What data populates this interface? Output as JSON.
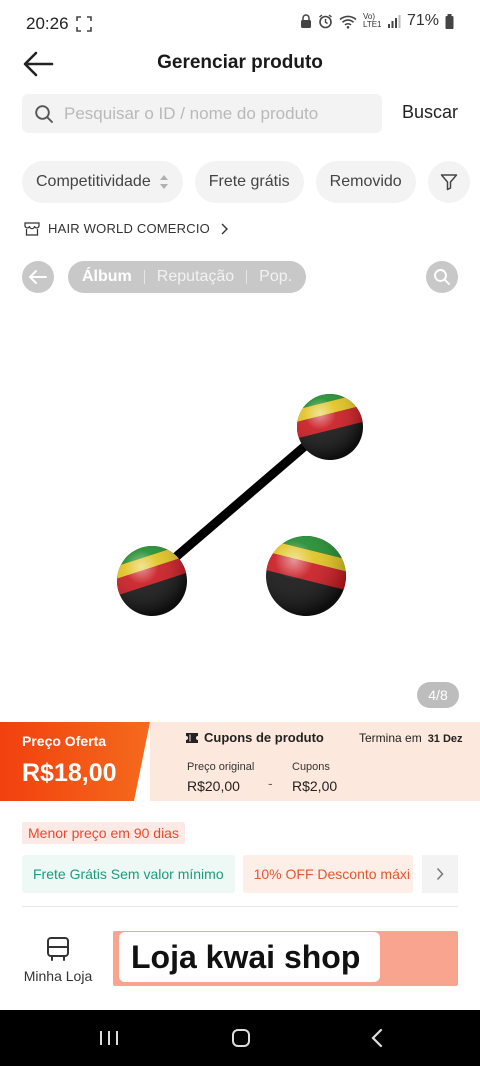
{
  "status_bar": {
    "time": "20:26",
    "network": "Vo)\nLTE1",
    "battery": "71%"
  },
  "header": {
    "title": "Gerenciar produto"
  },
  "search": {
    "placeholder": "Pesquisar o ID / nome do produto",
    "button": "Buscar"
  },
  "filters": [
    {
      "label": "Competitividade"
    },
    {
      "label": "Frete grátis"
    },
    {
      "label": "Removido"
    }
  ],
  "shop": {
    "name": "HAIR WORLD COMERCIO"
  },
  "album_tabs": [
    "Álbum",
    "Reputação",
    "Pop."
  ],
  "gallery": {
    "indicator": "4/8"
  },
  "price": {
    "offer_label": "Preço Oferta",
    "offer_value": "R$18,00",
    "coupons_title": "Cupons de produto",
    "ends_label": "Termina em",
    "ends_date": "31 Dez",
    "original_label": "Preço original",
    "original_value": "R$20,00",
    "minus": "-",
    "coupons_label": "Cupons",
    "coupons_value": "R$2,00"
  },
  "lowest_price_badge": "Menor preço em 90 dias",
  "promos": [
    "Frete Grátis Sem valor mínimo",
    "10% OFF Desconto máxi"
  ],
  "bottom": {
    "my_store": "Minha Loja",
    "cta": "Loja kwai shop"
  },
  "colors": {
    "accent_orange": "#f04a1c",
    "coupon_bg": "#fde8dd",
    "promo_green": "#1d9b7b",
    "promo_orange": "#e4572e",
    "cta_bg": "#f9a48f"
  }
}
